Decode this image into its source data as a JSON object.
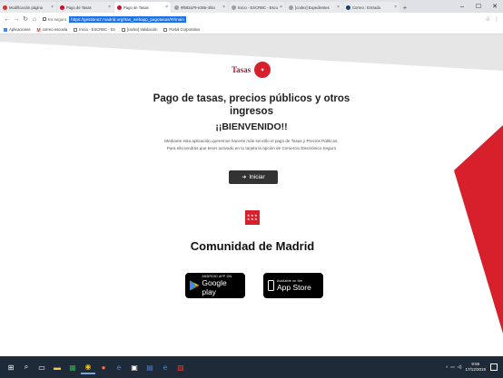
{
  "browser": {
    "tabs": [
      {
        "label": "Modificación página",
        "favicon_color": "#d93025",
        "active": false
      },
      {
        "label": "Pago de Tasas",
        "favicon_color": "#c8102e",
        "active": false
      },
      {
        "label": "Pago de Tasas",
        "favicon_color": "#c8102e",
        "active": true
      },
      {
        "label": "9f583a79-e355-4f4a",
        "favicon_color": "#9aa0a6",
        "active": false
      },
      {
        "label": "Inicio - ESCRBC - Escu",
        "favicon_color": "#9aa0a6",
        "active": false
      },
      {
        "label": "[codex] Expedientes",
        "favicon_color": "#9aa0a6",
        "active": false
      },
      {
        "label": "Correo : Entrada",
        "favicon_color": "#1a3e72",
        "active": false
      }
    ],
    "window_controls": {
      "minimize": "–",
      "maximize": "☐",
      "close": "✕"
    },
    "secure_label": "Es seguro",
    "url": "https://gestiona7.madrid.org/rtas_webapp_pagotasas/#!/main",
    "bookmarks": [
      {
        "label": "Aplicaciones",
        "icon": "apps-icon"
      },
      {
        "label": "correo escuela",
        "icon": "gmail-icon"
      },
      {
        "label": "Inicio - ESCRBC - Es",
        "icon": "page-icon"
      },
      {
        "label": "[codex] Validación",
        "icon": "page-icon"
      },
      {
        "label": "Portal Corporativo",
        "icon": "page-icon"
      }
    ]
  },
  "page": {
    "logo_word": "Tasas",
    "title": "Pago de tasas, precios públicos y otros ingresos",
    "welcome": "¡¡BIENVENIDO!!",
    "description": "Mediante esta aplicación queremos hacerte más sencillo el pago de Tasas y Precios Públicos. Para ello tendrás que tener activado en tu tarjeta la opción de Comercio Electrónico Seguro",
    "start_button": "Iniciar",
    "organization": "Comunidad de Madrid",
    "stores": {
      "google_small": "ANDROID APP ON",
      "google_big": "Google play",
      "apple_small": "Available on the",
      "apple_big": "App Store"
    }
  },
  "taskbar": {
    "time": "9:56",
    "date": "17/12/2019"
  },
  "colors": {
    "accent_red": "#d8202c",
    "url_highlight": "#1a73e8",
    "taskbar": "#1e2a38"
  }
}
